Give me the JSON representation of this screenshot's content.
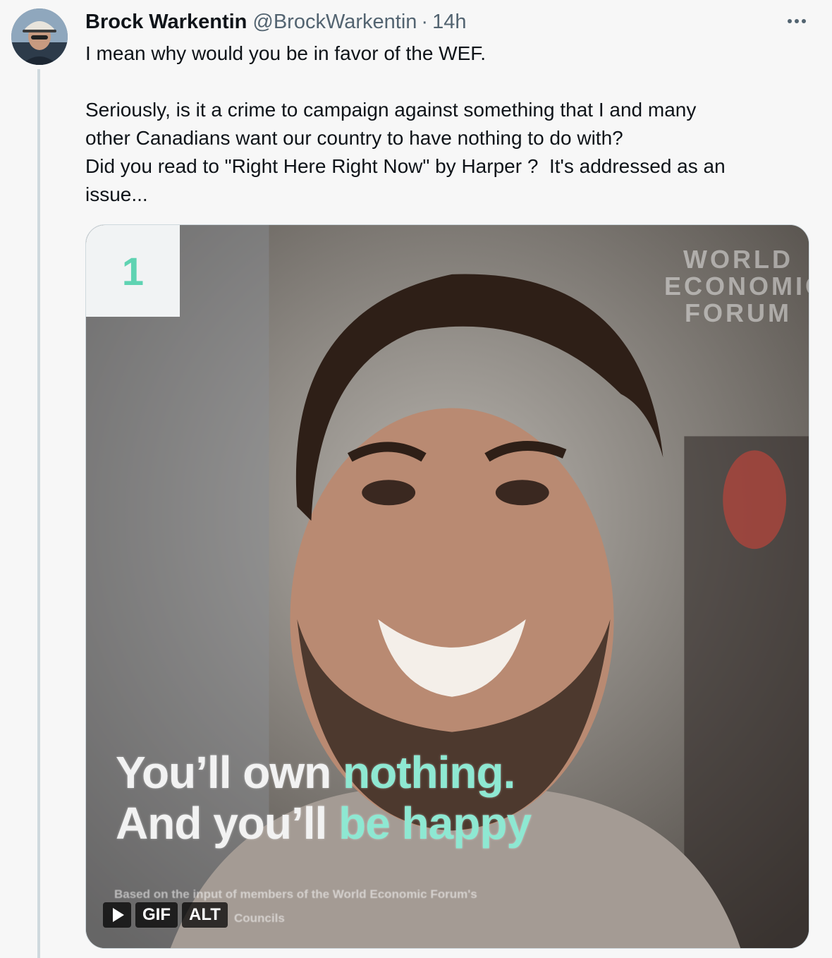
{
  "tweet": {
    "author_name": "Brock Warkentin",
    "handle": "@BrockWarkentin",
    "separator": "·",
    "time": "14h",
    "paragraphs": [
      "I mean why would you be in favor of the WEF.",
      "Seriously, is it a crime to campaign against something that I and many\nother Canadians want our country to have nothing to do with?\nDid you read to \"Right Here Right Now\" by Harper ?  It's addressed as an\nissue..."
    ]
  },
  "media": {
    "overlay_number": "1",
    "logo_lines": [
      "WORLD",
      "ECONOMIC",
      "FORUM"
    ],
    "caption_line1_a": "You’ll own ",
    "caption_line1_b": "nothing.",
    "caption_line2_a": "And you’ll ",
    "caption_line2_b": "be happy",
    "fine_print_1": "Based on the input of members of the World Economic Forum's",
    "fine_print_2": "Councils",
    "gif_label": "GIF",
    "alt_label": "ALT"
  },
  "colors": {
    "accent_teal": "#8ee8d2",
    "name_text": "#0f1419",
    "secondary_text": "#536471"
  }
}
